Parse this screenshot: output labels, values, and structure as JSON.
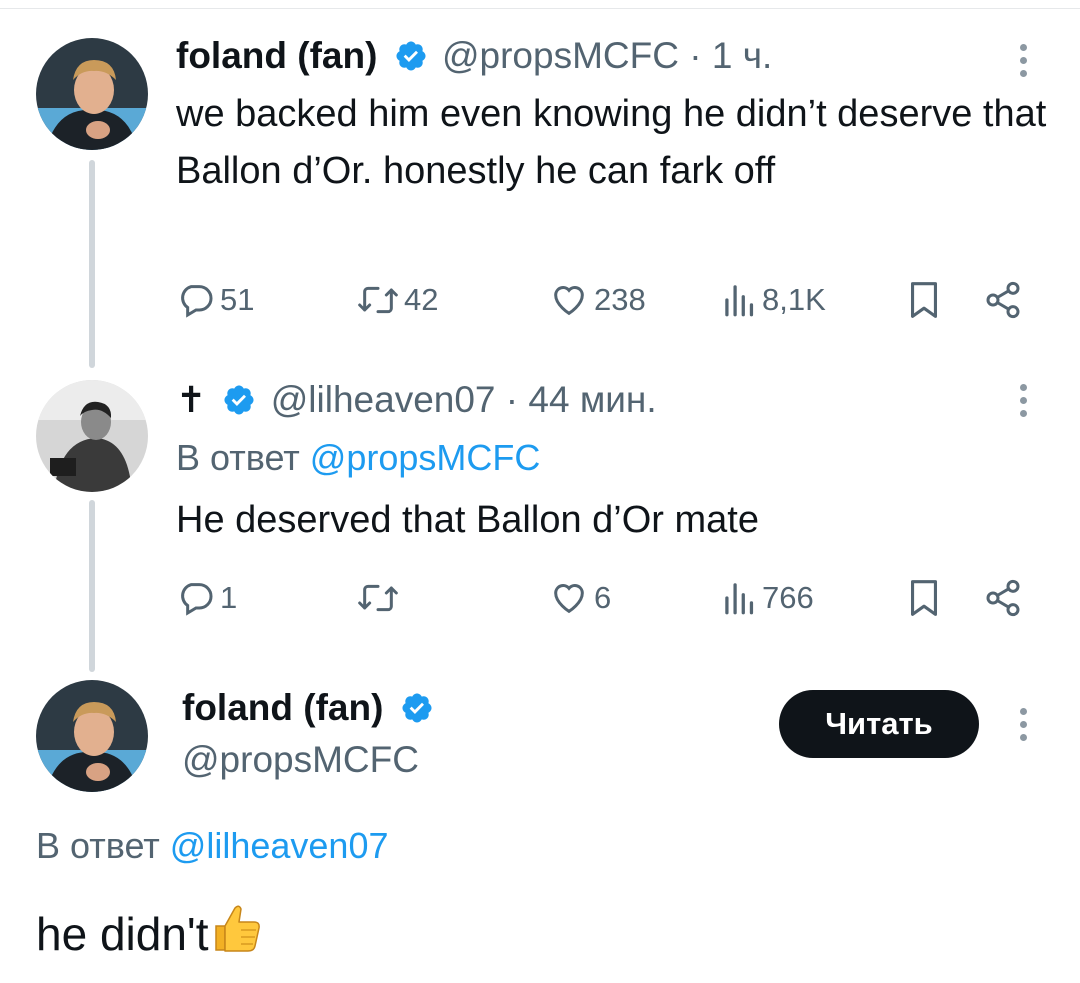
{
  "tweets": [
    {
      "author_name": "foland (fan)",
      "handle": "@propsMCFC",
      "separator": "·",
      "time": "1 ч.",
      "text": "we backed him even knowing he didn’t deserve that Ballon d’Or. honestly he can fark off",
      "stats": {
        "replies": "51",
        "retweets": "42",
        "likes": "238",
        "views": "8,1K"
      }
    },
    {
      "author_name": "✝",
      "handle": "@lilheaven07",
      "separator": "·",
      "time": "44 мин.",
      "reply_prefix": "В ответ",
      "reply_handle": "@propsMCFC",
      "text": "He deserved that Ballon d’Or mate",
      "stats": {
        "replies": "1",
        "retweets": "",
        "likes": "6",
        "views": "766"
      }
    }
  ],
  "main_post": {
    "author_name": "foland (fan)",
    "handle": "@propsMCFC",
    "follow_label": "Читать",
    "reply_prefix": "В ответ",
    "reply_handle": "@lilheaven07",
    "text": "he didn't",
    "emoji": "thumbs-up"
  },
  "icons": [
    "reply-icon",
    "retweet-icon",
    "like-icon",
    "views-icon",
    "bookmark-icon",
    "share-icon",
    "verified-icon",
    "more-icon"
  ],
  "colors": {
    "accent": "#1d9bf0",
    "text": "#0f1419",
    "secondary": "#536471",
    "thread_line": "#d0d6db",
    "button": "#0f1419"
  }
}
